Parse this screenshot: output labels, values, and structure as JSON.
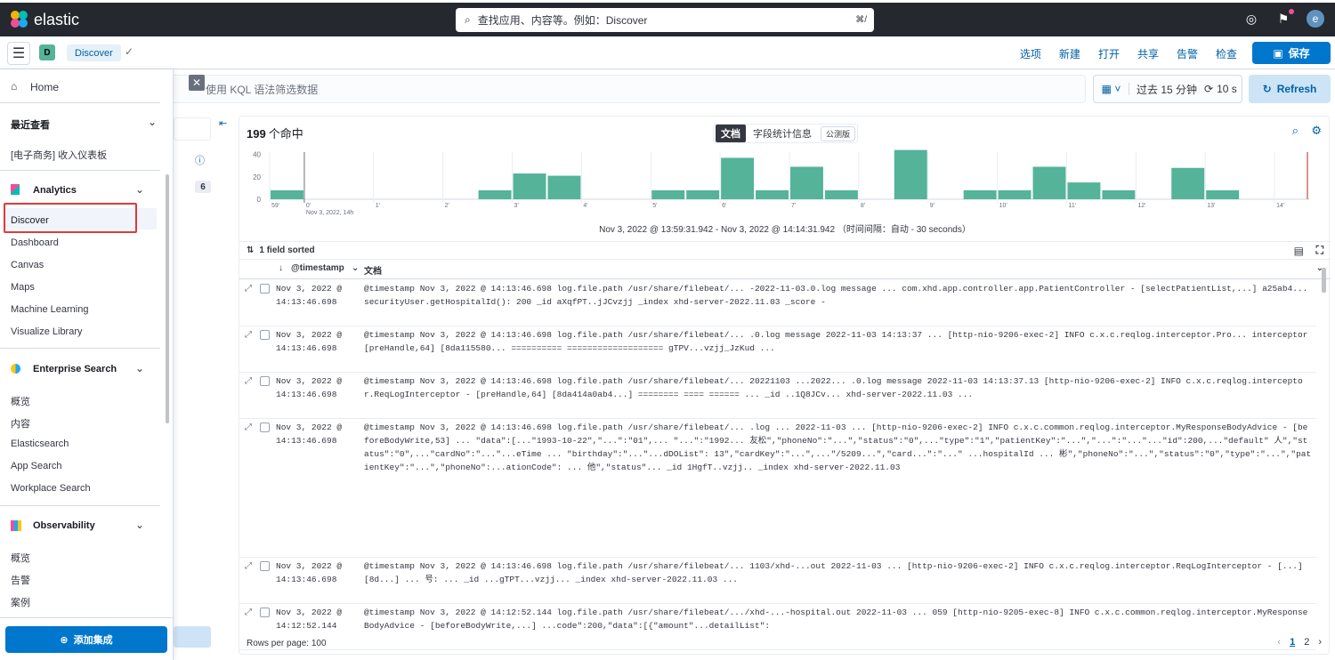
{
  "topbar": {
    "brand": "elastic",
    "search_placeholder": "查找应用、内容等。例如：Discover",
    "search_shortcut": "⌘/",
    "icons": [
      "help-icon",
      "newsfeed-icon",
      "user-avatar"
    ],
    "user_initial": "e"
  },
  "appbar": {
    "space_initial": "D",
    "breadcrumb": "Discover",
    "menu": [
      "选项",
      "新建",
      "打开",
      "共享",
      "告警",
      "检查"
    ],
    "save_label": "保存"
  },
  "nav": {
    "home": "Home",
    "recent_title": "最近查看",
    "recent_item": "[电子商务] 收入仪表板",
    "analytics_title": "Analytics",
    "analytics_items": [
      "Discover",
      "Dashboard",
      "Canvas",
      "Maps",
      "Machine Learning",
      "Visualize Library"
    ],
    "enterprise_title": "Enterprise Search",
    "enterprise_items": [
      "概览",
      "内容",
      "Elasticsearch",
      "App Search",
      "Workplace Search"
    ],
    "observability_title": "Observability",
    "observability_items": [
      "概览",
      "告警",
      "案例"
    ],
    "add_integration": "添加集成"
  },
  "query": {
    "placeholder": "使用 KQL 语法筛选数据",
    "date_range": "过去 15 分钟",
    "refresh_interval": "10 s",
    "refresh_label": "Refresh"
  },
  "sidebar": {
    "count": "6"
  },
  "results": {
    "hits": "199",
    "hits_suffix": "个命中",
    "tab_documents": "文档",
    "tab_field_stats": "字段统计信息",
    "beta_badge": "公测版",
    "time_range": "Nov 3, 2022 @ 13:59:31.942 - Nov 3, 2022 @ 14:14:31.942  （时间间隔：自动 - 30 seconds）",
    "sorted": "1 field sorted",
    "col_timestamp": "@timestamp",
    "col_document": "文档",
    "rows_per_page": "Rows per page: 100",
    "pages": [
      "1",
      "2"
    ]
  },
  "chart_data": {
    "type": "bar",
    "ylim": [
      0,
      40
    ],
    "yticks": [
      "40",
      "20",
      "0"
    ],
    "xtick_labels": [
      "59'",
      "0'",
      "1'",
      "2'",
      "3'",
      "4'",
      "5'",
      "6'",
      "7'",
      "8'",
      "9'",
      "10'",
      "11'",
      "12'",
      "13'",
      "14'"
    ],
    "sub_label": "Nov 3, 2022, 14h",
    "values": [
      8,
      0,
      0,
      0,
      0,
      0,
      8,
      23,
      21,
      0,
      0,
      8,
      8,
      37,
      8,
      29,
      8,
      0,
      44,
      0,
      8,
      8,
      29,
      15,
      8,
      0,
      28,
      8,
      0,
      0
    ],
    "color": "#54b399"
  },
  "rows": [
    {
      "date": "Nov 3, 2022 @",
      "time": "14:13:46.698",
      "doc": "@timestamp Nov 3, 2022 @ 14:13:46.698 log.file.path /usr/share/filebeat/... -2022-11-03.0.log message ... com.xhd.app.controller.app.PatientController - [selectPatientList,...] a25ab4... securityUser.getHospitalId(): 200 _id aXqfPT..jJCvzjj _index xhd-server-2022.11.03 _score -"
    },
    {
      "date": "Nov 3, 2022 @",
      "time": "14:13:46.698",
      "doc": "@timestamp Nov 3, 2022 @ 14:13:46.698 log.file.path /usr/share/filebeat/... .0.log message 2022-11-03 14:13:37 ... [http-nio-9206-exec-2] INFO c.x.c.reqlog.interceptor.Pro... interceptor [preHandle,64] [8da115580... ========== =================== gTPV...vzjj_JzKud ..."
    },
    {
      "date": "Nov 3, 2022 @",
      "time": "14:13:46.698",
      "doc": "@timestamp Nov 3, 2022 @ 14:13:46.698 log.file.path /usr/share/filebeat/... 20221103 ...2022... .0.log message 2022-11-03 14:13:37.13 [http-nio-9206-exec-2] INFO c.x.c.reqlog.interceptor.ReqLogInterceptor - [preHandle,64] [8da414a0ab4...] ======== ==== ====== ... _id ..1Q8JCv... xhd-server-2022.11.03 ..."
    },
    {
      "date": "Nov 3, 2022 @",
      "time": "14:13:46.698",
      "doc": "@timestamp Nov 3, 2022 @ 14:13:46.698 log.file.path /usr/share/filebeat/... .log ... 2022-11-03 ... [http-nio-9206-exec-2] INFO c.x.c.common.reqlog.interceptor.MyResponseBodyAdvice - [beforeBodyWrite,53] ... \"data\":[...\"1993-10-22\",\"...\":\"01\",... \"...\":\"1992... 友松\",\"phoneNo\":\"...\",\"status\":\"0\",...\"type\":\"1\",\"patientKey\":\"...\",\"...\":\"...\"...\"id\":200,...\"default\" 人\",\"status\":\"0\",...\"cardNo\":\"...\"...eTime ... \"birthday\":\"...\"...dDOList\": 13\",\"cardKey\":\"...\",...\"/5209...\",\"card...\":\"...\" ...hospitalId ... 彬\",\"phoneNo\":\"...\",\"status\":\"0\",\"type\":\"...\",\"patientKey\":\"...\",\"phoneNo\":...ationCode\": ... 他\",\"status\"... _id 1HgfT..vzjj.. _index xhd-server-2022.11.03"
    },
    {
      "date": "Nov 3, 2022 @",
      "time": "14:13:46.698",
      "doc": "@timestamp Nov 3, 2022 @ 14:13:46.698 log.file.path /usr/share/filebeat/... 1103/xhd-...out 2022-11-03 ... [http-nio-9206-exec-2] INFO c.x.c.reqlog.interceptor.ReqLogInterceptor - [...] [8d...] ... 号: ... _id ...gTPT...vzjj... _index xhd-server-2022.11.03 ..."
    },
    {
      "date": "Nov 3, 2022 @",
      "time": "14:12:52.144",
      "doc": "@timestamp Nov 3, 2022 @ 14:12:52.144 log.file.path /usr/share/filebeat/.../xhd-...-hospital.out 2022-11-03 ... 059 [http-nio-9205-exec-8] INFO c.x.c.common.reqlog.interceptor.MyResponseBodyAdvice - [beforeBodyWrite,...] ...code\":200,\"data\":[{\"amount\"...detailList\":"
    }
  ]
}
